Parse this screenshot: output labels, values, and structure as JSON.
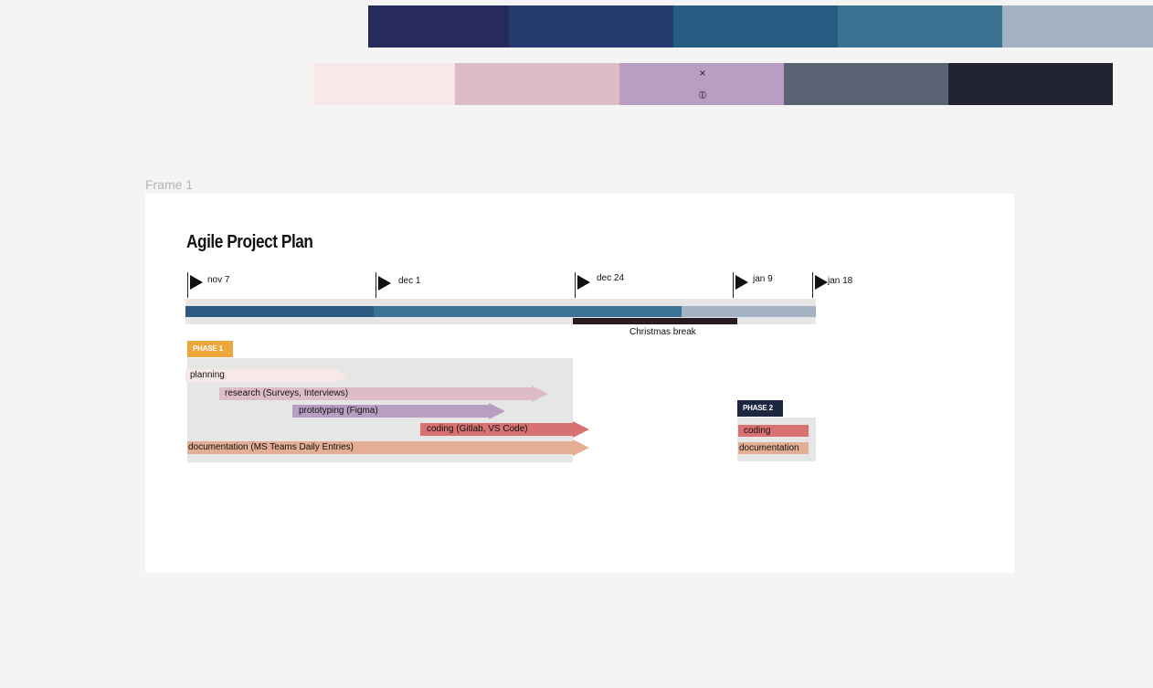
{
  "palettes": {
    "top": [
      {
        "color": "#262a5c",
        "width": 154
      },
      {
        "color": "#253a6e",
        "width": 180
      },
      {
        "color": "#265b82",
        "width": 180
      },
      {
        "color": "#387391",
        "width": 180
      },
      {
        "color": "#a2b2c2",
        "width": 166
      }
    ],
    "bottom": [
      {
        "color": "#f8e8e8",
        "width": 154
      },
      {
        "color": "#ddbcc7",
        "width": 180
      },
      {
        "color": "#b89ec2",
        "width": 180
      },
      {
        "color": "#5a6373",
        "width": 180
      },
      {
        "color": "#222330",
        "width": 180
      }
    ],
    "close_glyph": "×",
    "pin_glyph": "⦶"
  },
  "frame": {
    "label": "Frame 1"
  },
  "plan": {
    "title": "Agile Project Plan",
    "milestones": [
      {
        "label": "nov 7"
      },
      {
        "label": "dec 1"
      },
      {
        "label": "dec 24"
      },
      {
        "label": "jan 9"
      },
      {
        "label": "jan 18"
      }
    ],
    "timeline_colors": [
      "#2a5a82",
      "#3a7393",
      "#a3b3c3"
    ],
    "break_label": "Christmas break",
    "phase1": {
      "badge": "PHASE 1",
      "badge_color": "#eda73c",
      "tasks": [
        {
          "label": "planning",
          "color": "#f8e8e8"
        },
        {
          "label": "research (Surveys, Interviews)",
          "color": "#ddbcc7"
        },
        {
          "label": "prototyping (Figma)",
          "color": "#b89ec2"
        },
        {
          "label": "coding (Gitlab, VS Code)",
          "color": "#d87171"
        },
        {
          "label": "documentation (MS Teams Daily Entries)",
          "color": "#e4ae94"
        }
      ]
    },
    "phase2": {
      "badge": "PHASE 2",
      "badge_color": "#1d2741",
      "tasks": [
        {
          "label": "coding",
          "color": "#d87171"
        },
        {
          "label": "documentation",
          "color": "#e4ae94"
        }
      ]
    }
  }
}
